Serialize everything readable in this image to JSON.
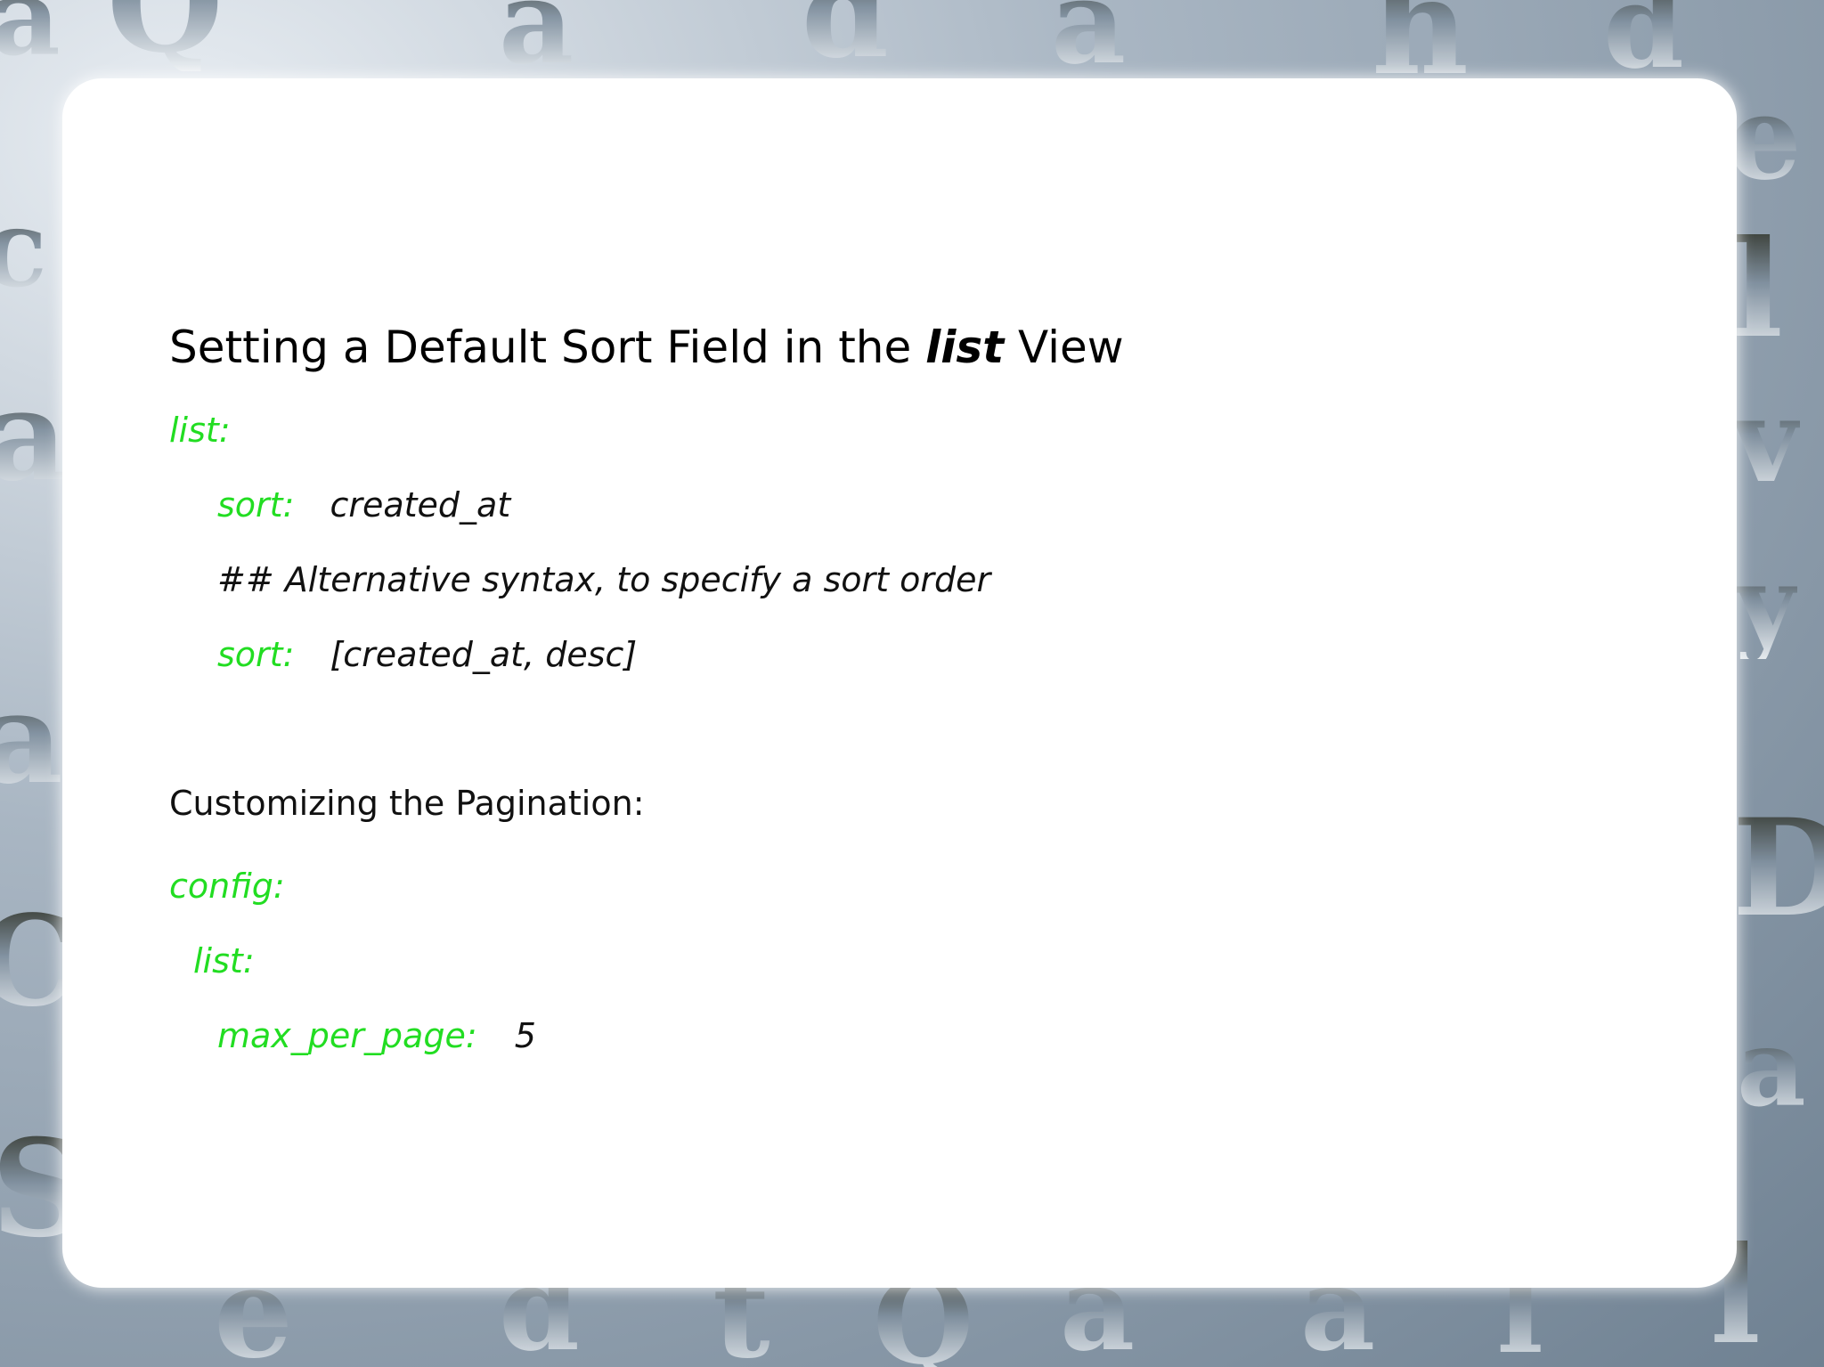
{
  "slide": {
    "title": {
      "prefix": "Setting a Default Sort Field in the ",
      "keyword": "list",
      "suffix": " View"
    },
    "code_block_1": {
      "line1_key": "list:",
      "line2_key": "sort:",
      "line2_value": "created_at",
      "line3_comment": "## Alternative syntax, to specify a sort order",
      "line4_key": "sort:",
      "line4_value": "[created_at, desc]"
    },
    "subheading": "Customizing the Pagination:",
    "code_block_2": {
      "line1_key": "config:",
      "line2_key": "list:",
      "line3_key": "max_per_page:",
      "line3_value": "5"
    }
  },
  "background": {
    "glyphs": [
      "a",
      "Q",
      "a",
      "d",
      "a",
      "h",
      "d",
      "c",
      "e",
      "a",
      "l",
      "v",
      "y",
      "D",
      "a",
      "l",
      "a",
      "C",
      "S",
      "e",
      "d",
      "a",
      "t",
      "Q",
      "a",
      "l"
    ]
  },
  "colors": {
    "code_key": "#22dd22",
    "code_value": "#111111",
    "slide_background": "#ffffff"
  }
}
